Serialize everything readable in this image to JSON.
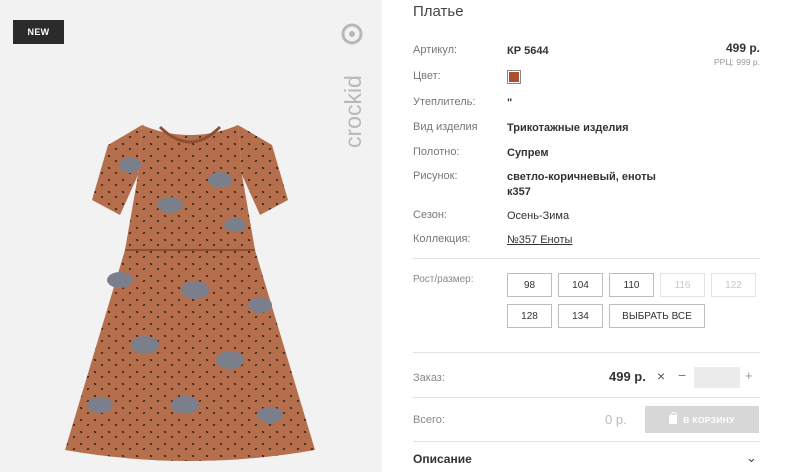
{
  "badge": "NEW",
  "brand": "crockid",
  "product": {
    "title": "Платье",
    "price": "499 р.",
    "rrc": "РРЦ: 999 р.",
    "color": "#a9502f",
    "props": [
      {
        "label": "Артикул:",
        "value": "КР 5644"
      },
      {
        "label": "Цвет:",
        "value": ""
      },
      {
        "label": "Утеплитель:",
        "value": "\""
      },
      {
        "label": "Вид изделия",
        "value": "Трикотажные изделия"
      },
      {
        "label": "Полотно:",
        "value": "Супрем"
      },
      {
        "label": "Рисунок:",
        "value": "светло-коричневый, еноты к357"
      },
      {
        "label": "Сезон:",
        "value": "Осень-Зима"
      },
      {
        "label": "Коллекция:",
        "value": "№357 Еноты"
      }
    ]
  },
  "sizes": {
    "label": "Рост/размер:",
    "items": [
      "98",
      "104",
      "110",
      "116",
      "122",
      "128",
      "134"
    ],
    "disabled": [
      false,
      false,
      false,
      true,
      true,
      false,
      false
    ],
    "select_all": "ВЫБРАТЬ ВСЕ"
  },
  "order": {
    "label": "Заказ:",
    "price": "499 р.",
    "times": "×",
    "minus": "−",
    "plus": "+",
    "qty": ""
  },
  "total": {
    "label": "Всего:",
    "value": "0 р.",
    "cart_button": "В КОРЗИНУ"
  },
  "description": {
    "title": "Описание",
    "chevron": "⌄"
  }
}
